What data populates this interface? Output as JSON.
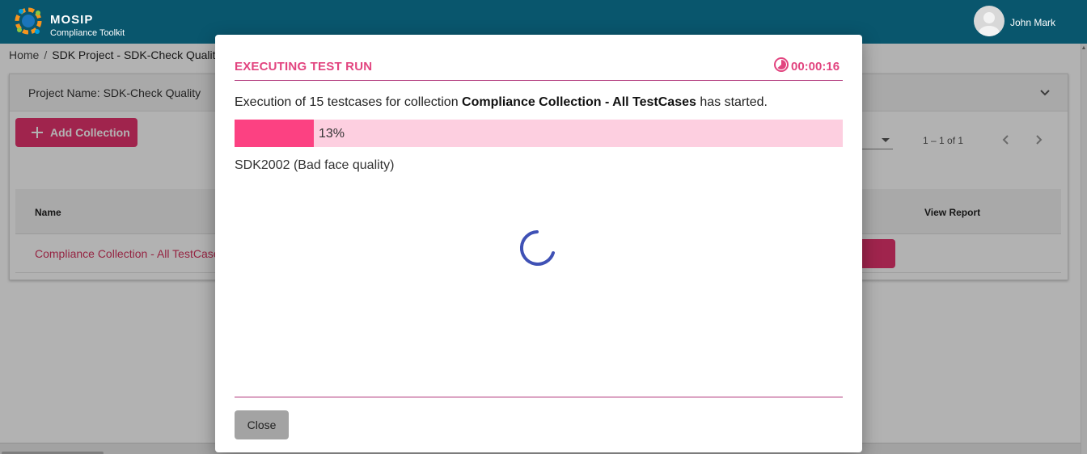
{
  "header": {
    "brand_name": "MOSIP",
    "brand_sub": "Compliance Toolkit",
    "user_name": "John Mark",
    "colors": {
      "bar": "#09566d",
      "logo_accents": [
        "#f7941d",
        "#00a0e3",
        "#1b75bb",
        "#8dc63f"
      ]
    }
  },
  "breadcrumb": {
    "home": "Home",
    "separator": "/",
    "current": "SDK Project - SDK-Check Quality"
  },
  "project": {
    "name_label": "Project Name: SDK-Check Quality",
    "add_collection_label": "Add Collection"
  },
  "paginator": {
    "range_label": "1 – 1 of 1"
  },
  "table": {
    "columns": [
      "Name",
      "View Report"
    ],
    "rows": [
      {
        "name": "Compliance Collection - All TestCases"
      }
    ]
  },
  "modal": {
    "title": "EXECUTING TEST RUN",
    "timer": "00:00:16",
    "message_prefix": "Execution of 15 testcases for collection",
    "collection_name": "Compliance Collection - All TestCases",
    "message_suffix": "has started.",
    "progress_percent": 13,
    "progress_label": "13%",
    "current_testcase": "SDK2002 (Bad face quality)",
    "close_label": "Close",
    "colors": {
      "accent": "#e2447f",
      "progress_fill": "#fc4182",
      "progress_track": "#fdcfe0",
      "spinner": "#3f51b5"
    }
  },
  "icons": [
    "mosip-logo-icon",
    "user-avatar-icon",
    "chevron-down-icon",
    "plus-icon",
    "dropdown-arrow-icon",
    "chevron-left-icon",
    "chevron-right-icon",
    "timer-icon",
    "loading-spinner-icon"
  ]
}
